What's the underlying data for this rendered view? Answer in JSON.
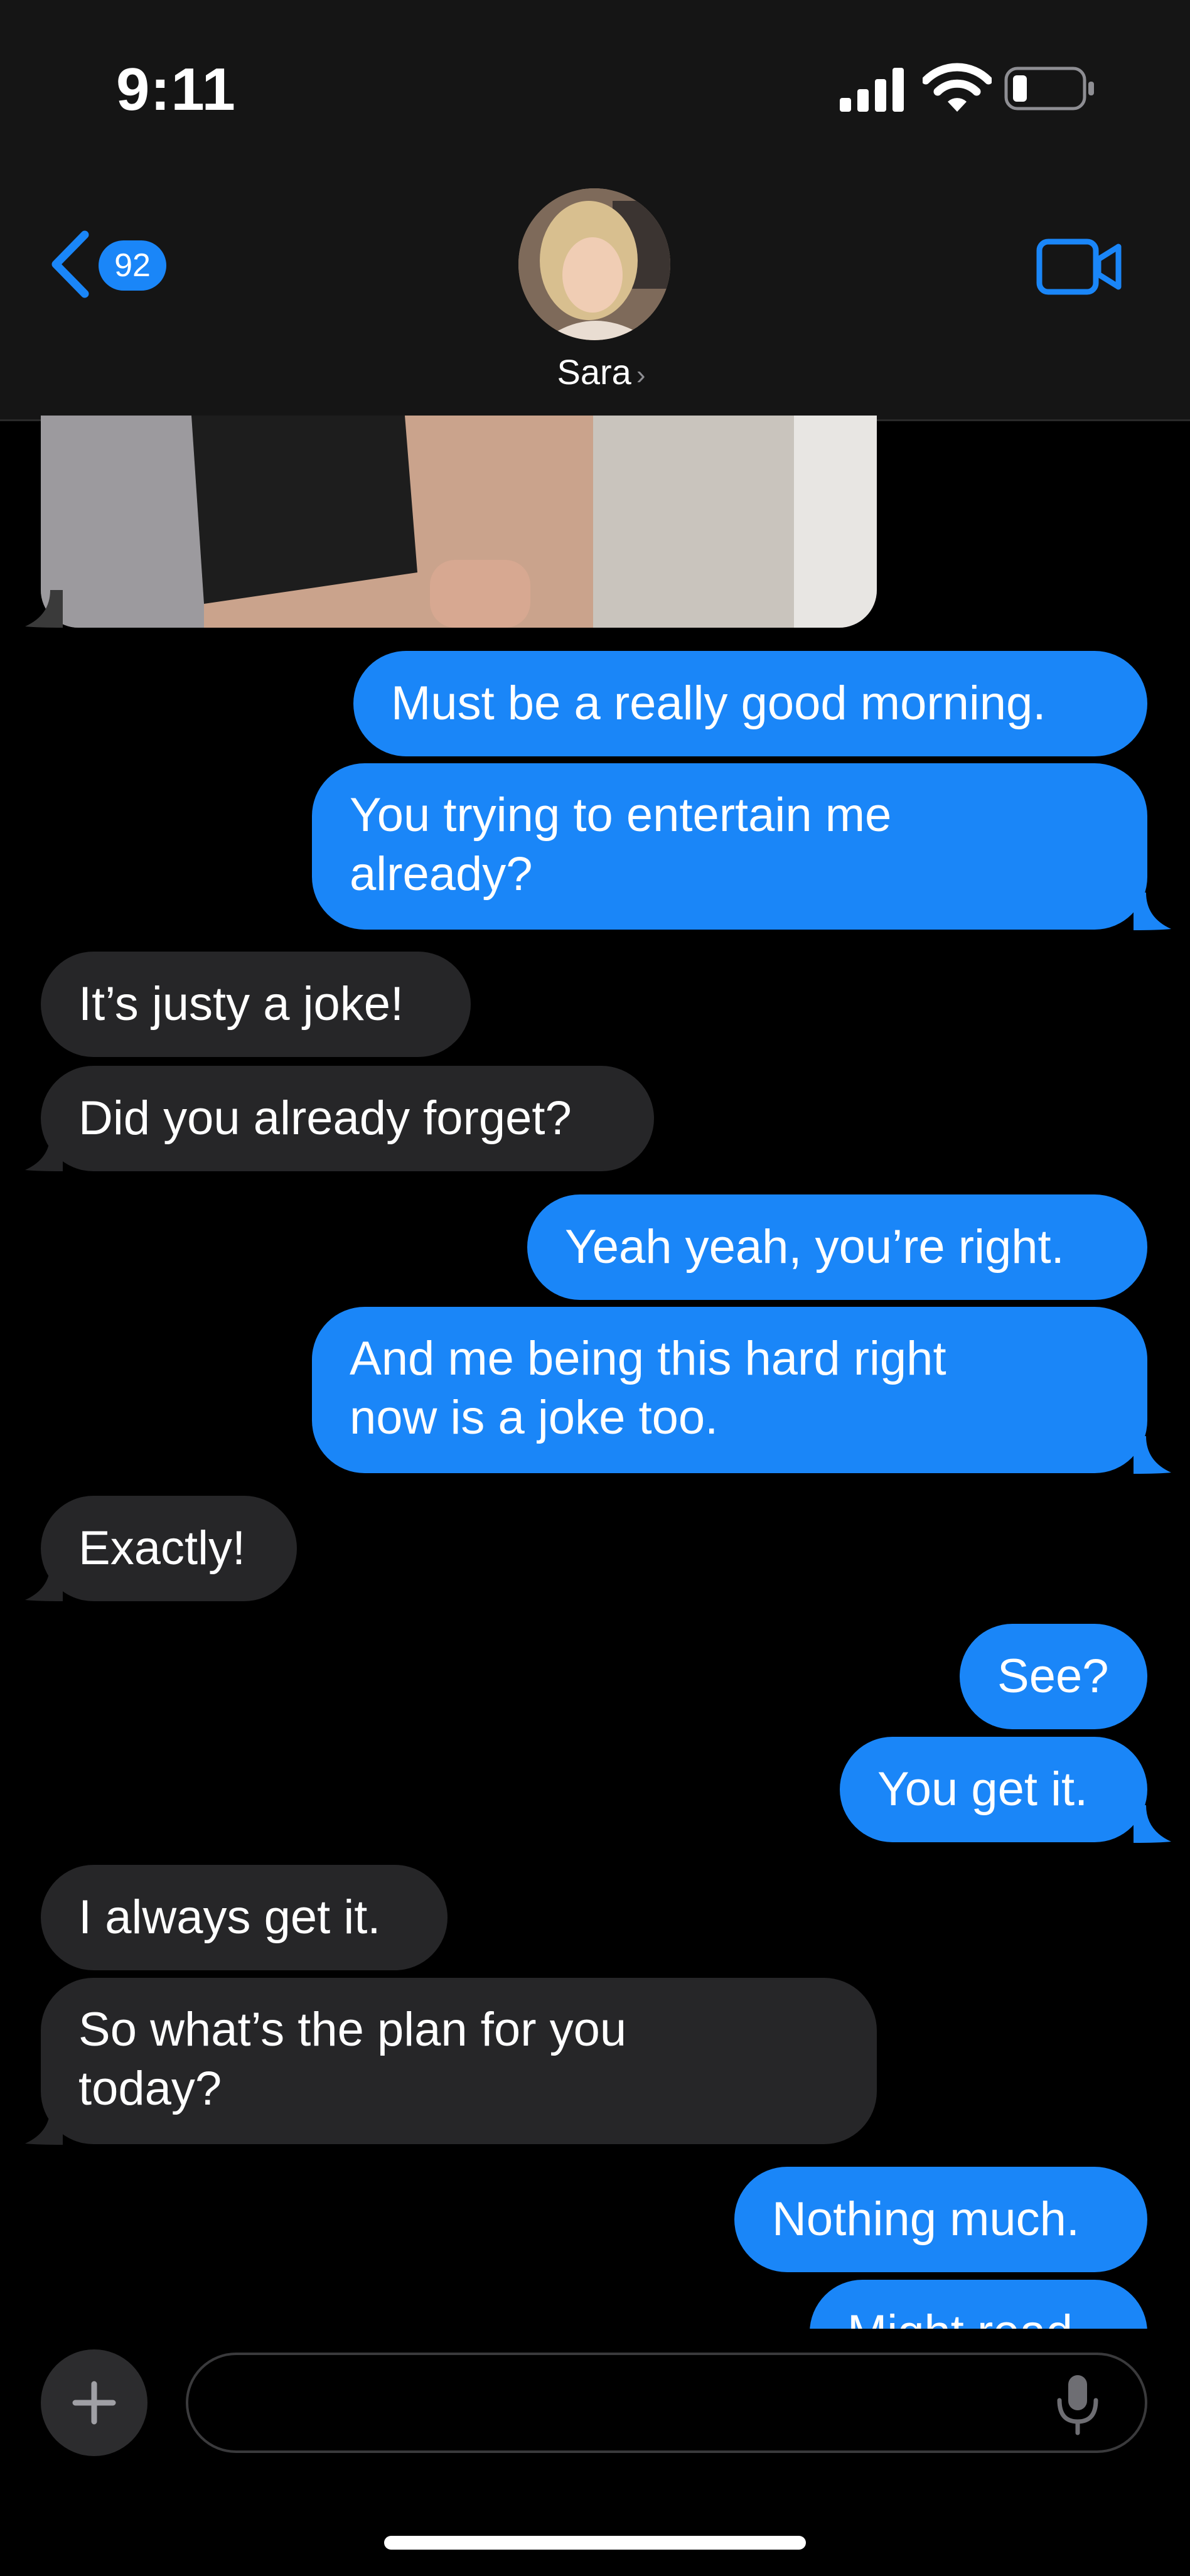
{
  "status_bar": {
    "time": "9:11"
  },
  "header": {
    "back_count": "92",
    "contact_name": "Sara",
    "icons": [
      "chevron-left-icon",
      "video-camera-icon",
      "chevron-right-icon"
    ]
  },
  "messages": [
    {
      "from": "me",
      "text": "Must be a really good morning."
    },
    {
      "from": "me",
      "lines": [
        "You trying to entertain me",
        "already?"
      ]
    },
    {
      "from": "them",
      "text": "It’s justy a joke!"
    },
    {
      "from": "them",
      "text": "Did you already forget?"
    },
    {
      "from": "me",
      "text": "Yeah yeah, you’re right."
    },
    {
      "from": "me",
      "lines": [
        "And me being this hard right",
        "now is a joke too."
      ]
    },
    {
      "from": "them",
      "text": "Exactly!"
    },
    {
      "from": "me",
      "text": "See?"
    },
    {
      "from": "me",
      "text": "You get it."
    },
    {
      "from": "them",
      "text": "I always get it."
    },
    {
      "from": "them",
      "lines": [
        "So what’s the plan for you",
        "today?"
      ]
    },
    {
      "from": "me",
      "text": "Nothing much."
    },
    {
      "from": "me",
      "text": "Might read"
    }
  ],
  "colors": {
    "sent_bubble": "#1a86f8",
    "received_bubble": "#262628",
    "background": "#000000"
  },
  "composer": {
    "placeholder": ""
  }
}
